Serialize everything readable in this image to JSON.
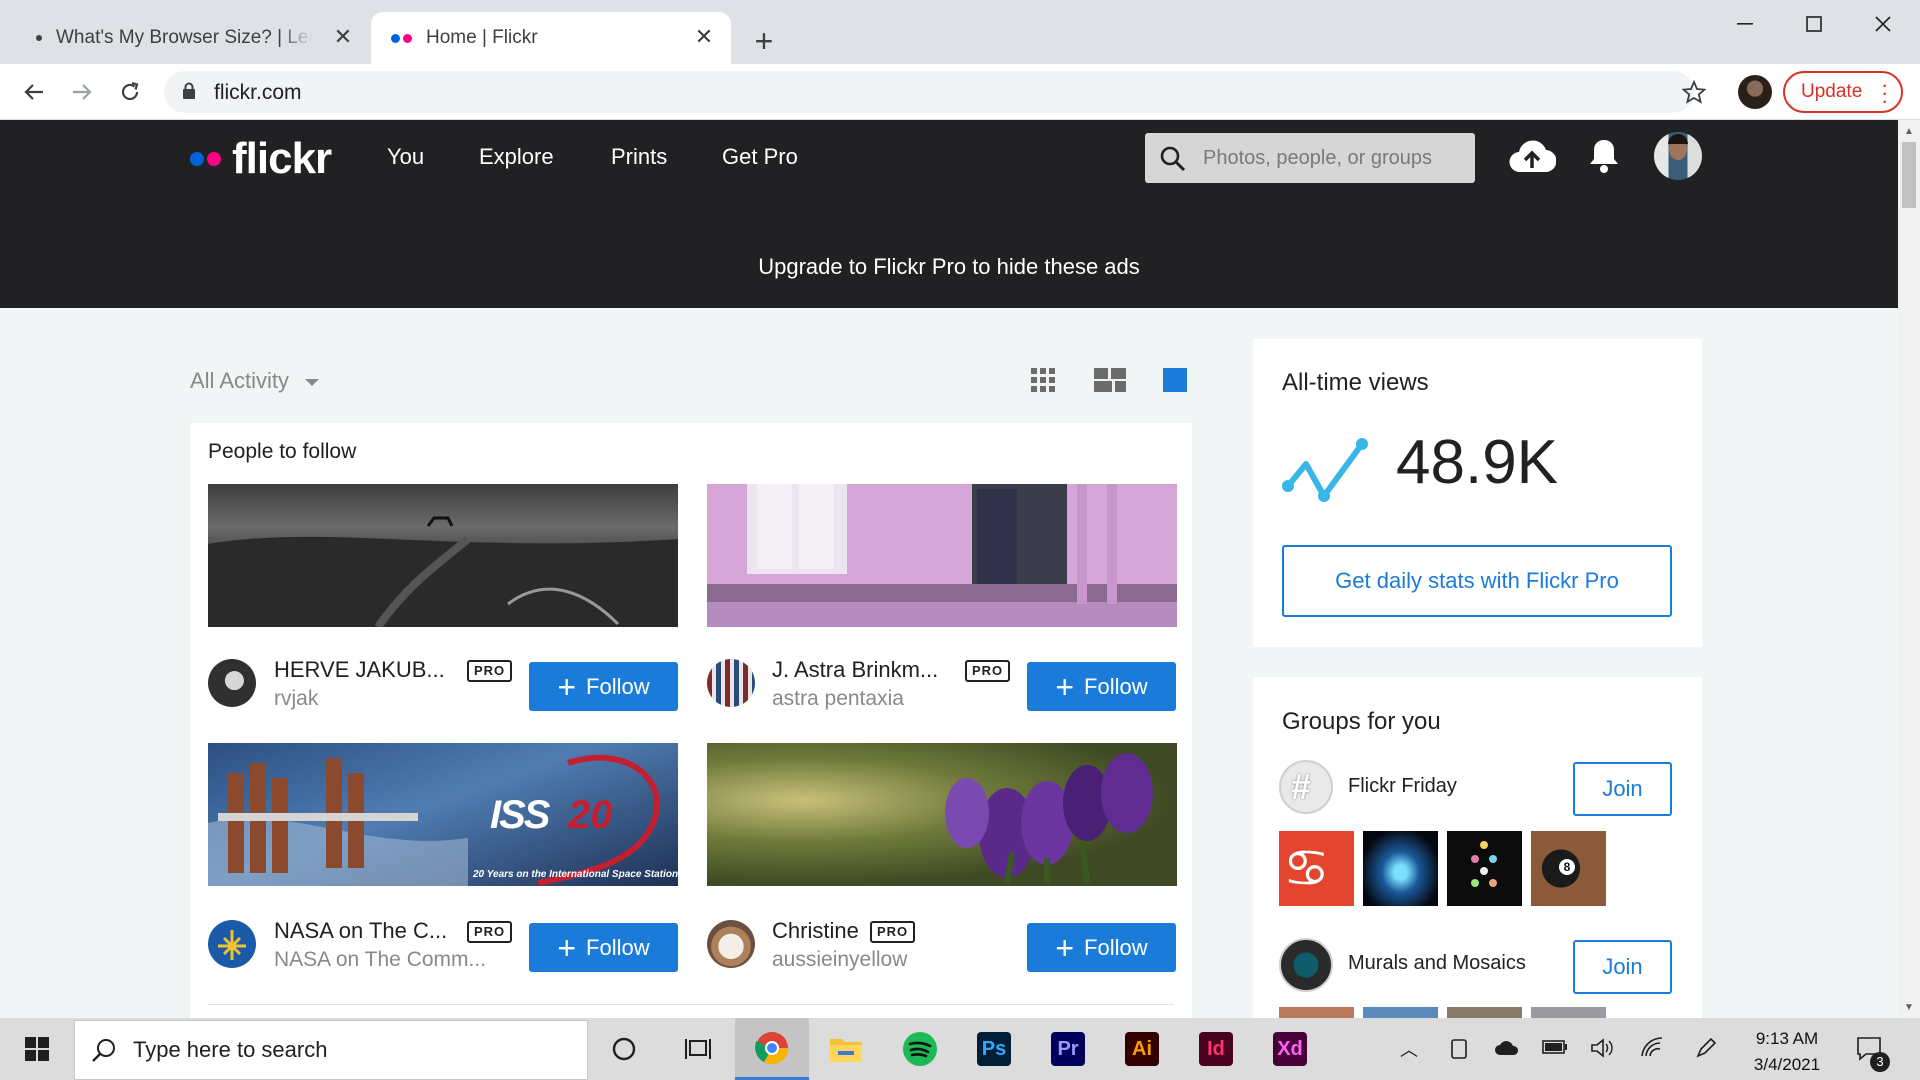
{
  "browser": {
    "tabs": [
      {
        "title": "What's My Browser Size? | Learn",
        "active": false
      },
      {
        "title": "Home | Flickr",
        "active": true
      }
    ],
    "url": "flickr.com",
    "update_label": "Update"
  },
  "flickr": {
    "logo_text": "flickr",
    "nav": [
      "You",
      "Explore",
      "Prints",
      "Get Pro"
    ],
    "search_placeholder": "Photos, people, or groups",
    "upgrade_banner": "Upgrade to Flickr Pro to hide these ads"
  },
  "feed": {
    "filter_label": "All Activity",
    "people_to_follow": {
      "title": "People to follow",
      "follow_label": "Follow",
      "pro_badge": "PRO",
      "people": [
        {
          "name": "HERVE JAKUB...",
          "username": "rvjak",
          "pro": true
        },
        {
          "name": "J. Astra Brinkm...",
          "username": "astra pentaxia",
          "pro": true
        },
        {
          "name": "NASA on The C...",
          "username": "NASA on The Comm...",
          "pro": true,
          "image_caption": "20 Years on the International Space Station"
        },
        {
          "name": "Christine",
          "username": "aussieinyellow",
          "pro": true
        }
      ]
    }
  },
  "sidebar": {
    "views": {
      "title": "All-time views",
      "count": "48.9K",
      "cta": "Get daily stats with Flickr Pro"
    },
    "groups": {
      "title": "Groups for you",
      "join_label": "Join",
      "items": [
        {
          "name": "Flickr Friday"
        },
        {
          "name": "Murals and Mosaics"
        }
      ]
    }
  },
  "taskbar": {
    "search_placeholder": "Type here to search",
    "time": "9:13 AM",
    "date": "3/4/2021",
    "notification_count": "3",
    "apps": [
      "task-view",
      "chrome",
      "file-explorer",
      "spotify",
      "photoshop",
      "premiere",
      "illustrator",
      "indesign",
      "xd"
    ],
    "app_labels": {
      "ps": "Ps",
      "pr": "Pr",
      "ai": "Ai",
      "id": "Id",
      "xd": "Xd"
    }
  },
  "colors": {
    "flickr_blue": "#0063dc",
    "flickr_pink": "#ff0084",
    "follow_blue": "#1a7bd8",
    "header_bg": "#212124",
    "update_red": "#d93025"
  }
}
